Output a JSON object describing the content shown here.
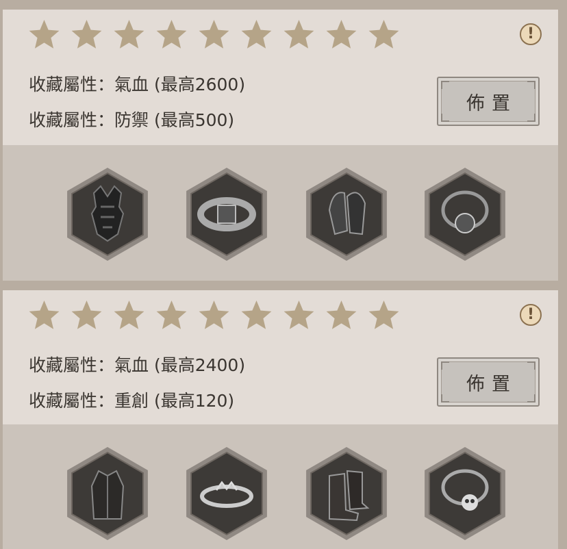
{
  "colors": {
    "star": "#b5a488",
    "hex_outer": "#908983",
    "hex_inner": "#3d3a37",
    "info_bg": "#ecd9b9"
  },
  "cards": [
    {
      "star_count": 9,
      "info_icon": "!",
      "attributes": [
        "收藏屬性：氣血 (最高2600)",
        "收藏屬性：防禦 (最高500)"
      ],
      "deploy_label": "佈置",
      "items": [
        "armor-item-icon",
        "ring-item-icon",
        "gloves-item-icon",
        "necklace-item-icon"
      ]
    },
    {
      "star_count": 9,
      "info_icon": "!",
      "attributes": [
        "收藏屬性：氣血 (最高2400)",
        "收藏屬性：重創 (最高120)"
      ],
      "deploy_label": "佈置",
      "items": [
        "robe-item-icon",
        "circlet-item-icon",
        "boots-item-icon",
        "skull-necklace-item-icon"
      ]
    }
  ]
}
